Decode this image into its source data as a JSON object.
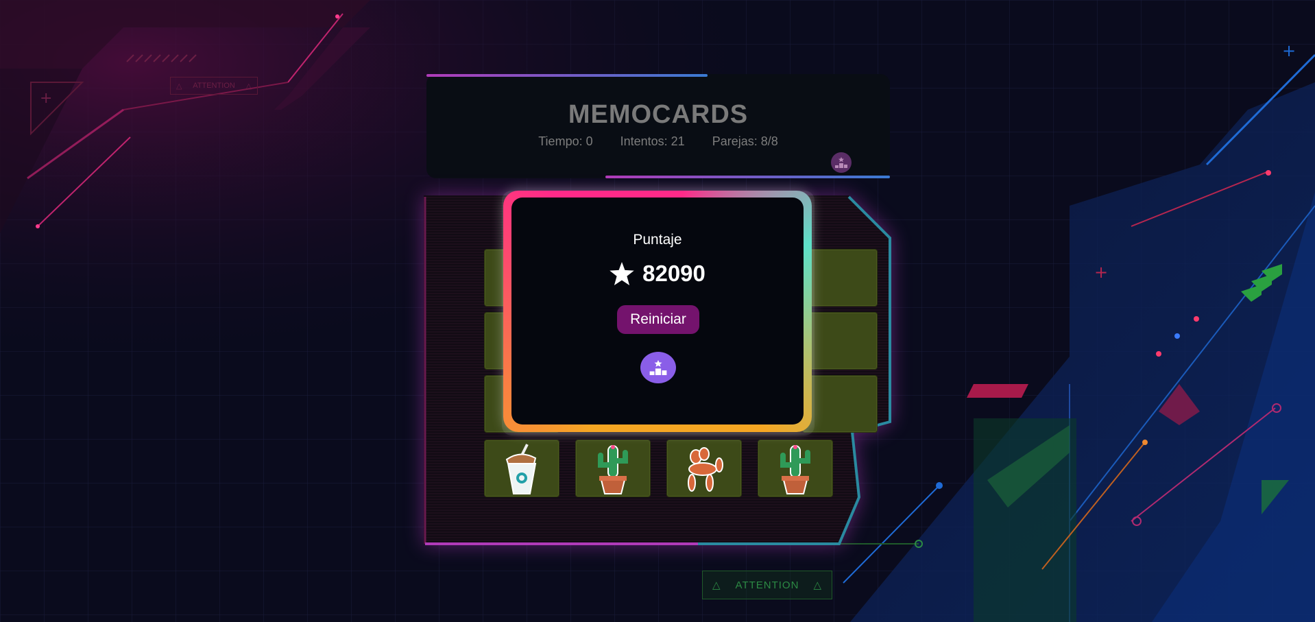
{
  "header": {
    "title": "MEMOCARDS",
    "time_label": "Tiempo:",
    "time_value": "0",
    "attempts_label": "Intentos:",
    "attempts_value": "21",
    "pairs_label": "Parejas:",
    "pairs_value": "8/8"
  },
  "modal": {
    "score_label": "Puntaje",
    "score_value": "82090",
    "restart_label": "Reiniciar"
  },
  "decor": {
    "attention_bottom": "ATTENTION",
    "attention_top": "ATTENTION"
  },
  "cards_bottom_row": [
    "drink-cup-icon",
    "cactus-icon",
    "balloon-dog-icon",
    "cactus-icon"
  ],
  "colors": {
    "background": "#0a0b1d",
    "accent_purple": "#74136d",
    "rank_button": "#8a5ee8",
    "card_fill": "#3d4a18"
  }
}
